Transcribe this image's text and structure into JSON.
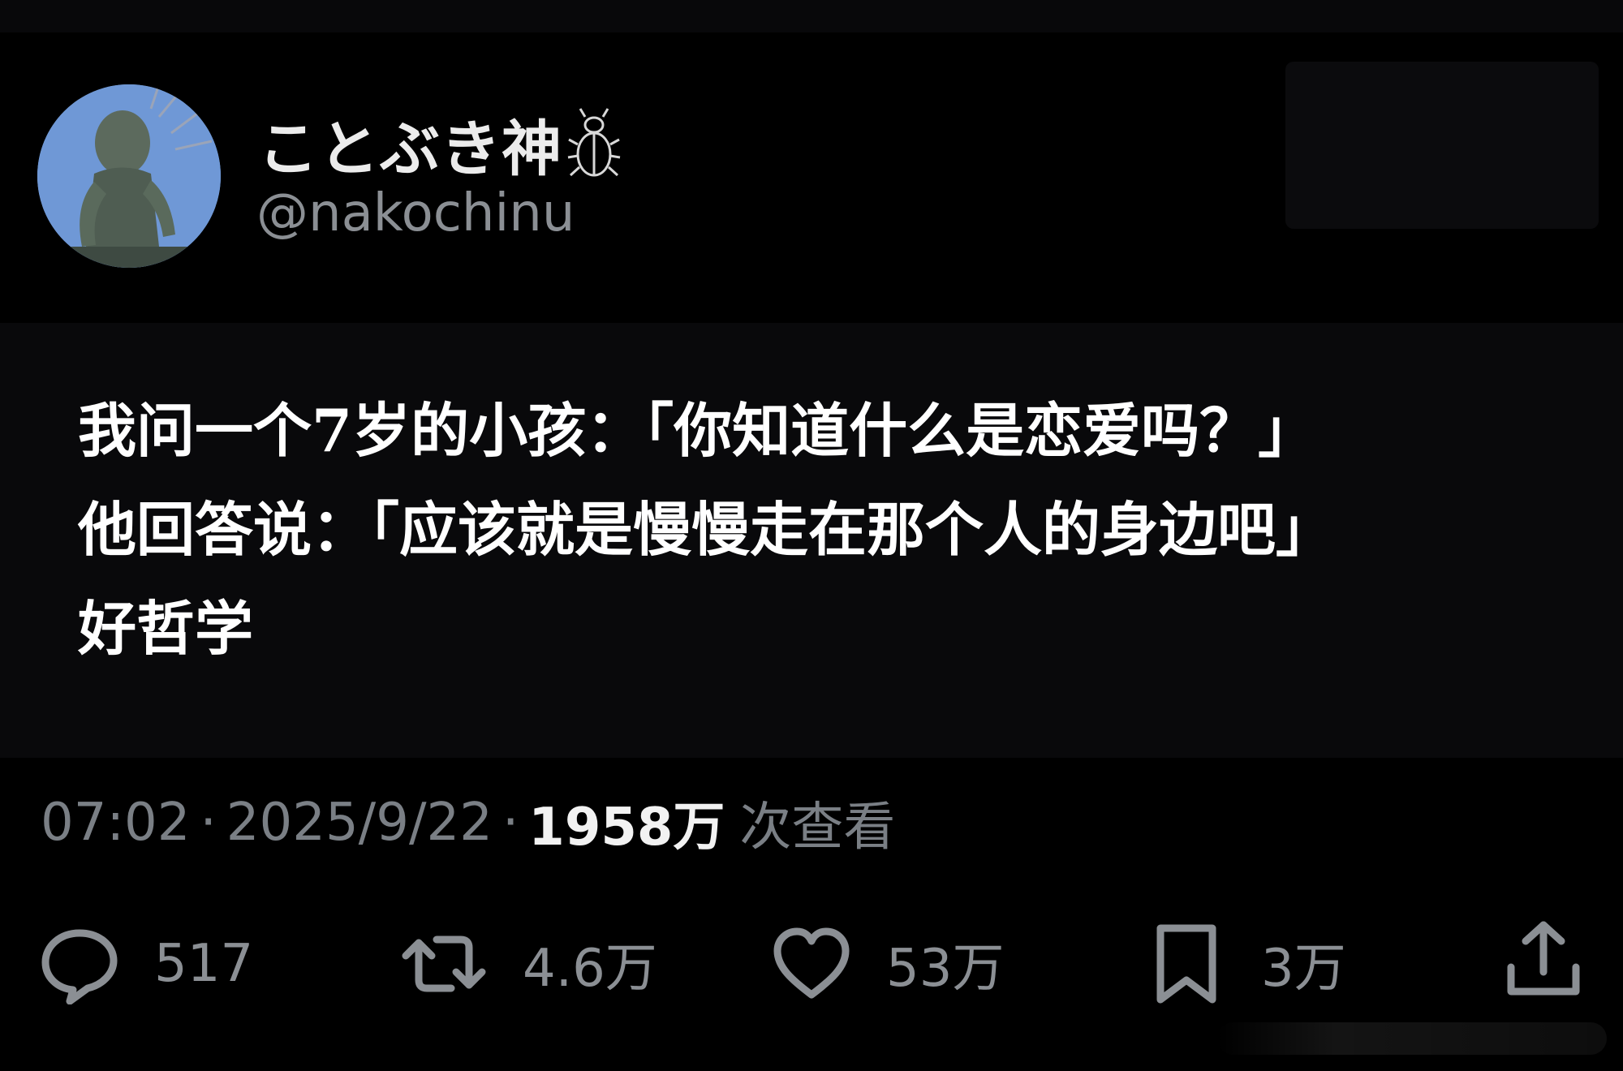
{
  "profile": {
    "display_name": "ことぶき神",
    "handle": "@nakochinu"
  },
  "tweet": {
    "lines": [
      "我问一个7岁的小孩：「你知道什么是恋爱吗？」",
      "他回答说：「应该就是慢慢走在那个人的身边吧」",
      "好哲学"
    ]
  },
  "meta": {
    "time": "07:02",
    "date": "2025/9/22",
    "views": "1958万",
    "views_label": "次查看",
    "separator": "·"
  },
  "actions": {
    "reply_count": "517",
    "retweet_count": "4.6万",
    "like_count": "53万",
    "bookmark_count": "3万"
  },
  "icons": {
    "reply": "reply-bubble-icon",
    "retweet": "retweet-arrows-icon",
    "like": "heart-icon",
    "bookmark": "bookmark-icon",
    "share": "share-upload-icon",
    "name_suffix": "beetle-emoji-icon"
  },
  "colors": {
    "background": "#000000",
    "text_primary": "#ffffff",
    "text_secondary": "#8b8f94"
  }
}
